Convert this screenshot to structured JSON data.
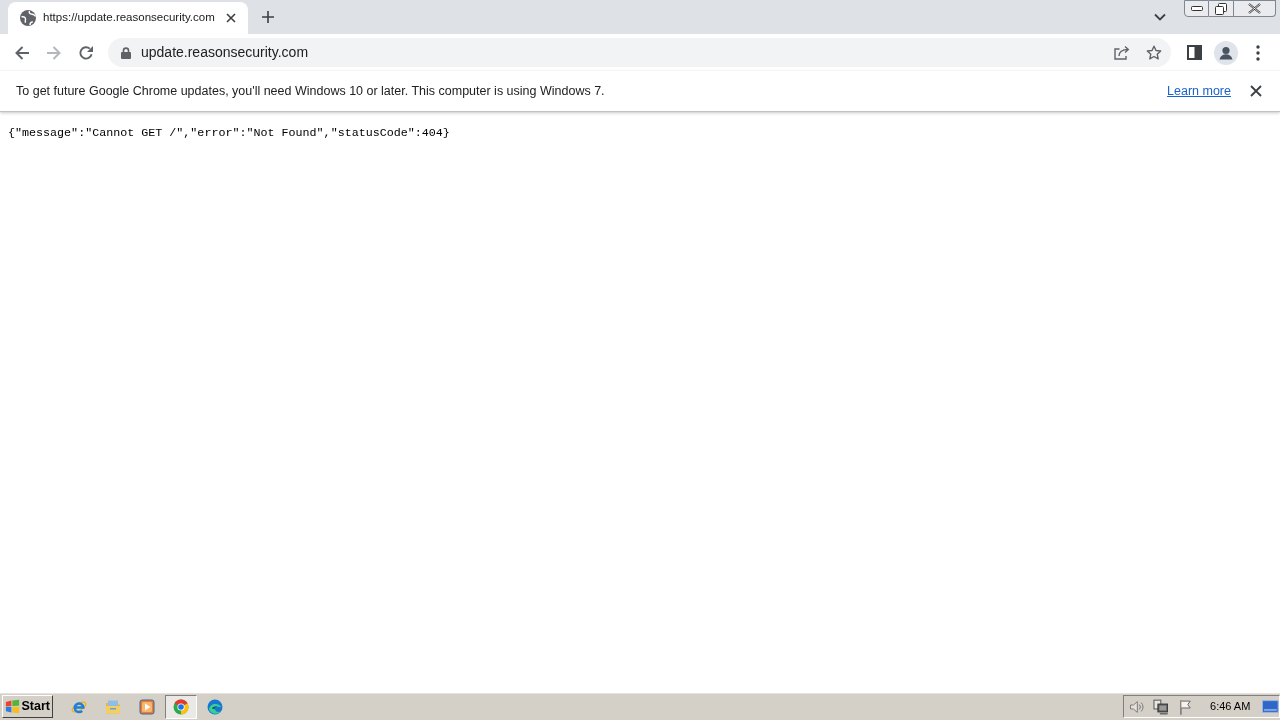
{
  "browser": {
    "tabs": [
      {
        "title": "https://update.reasonsecurity.com",
        "selected": true
      }
    ],
    "navigation": {
      "back_disabled": false,
      "forward_disabled": true
    },
    "address_bar": {
      "url": "update.reasonsecurity.com"
    },
    "infobar": {
      "message": "To get future Google Chrome updates, you'll need Windows 10 or later. This computer is using Windows 7.",
      "link": "Learn more"
    },
    "page": {
      "body": "{\"message\":\"Cannot GET /\",\"error\":\"Not Found\",\"statusCode\":404}"
    }
  },
  "taskbar": {
    "start_button": "Start",
    "quick_launch": [
      {
        "kind": "e_logo",
        "selected": false
      },
      {
        "kind": "folder",
        "selected": false
      },
      {
        "kind": "player",
        "selected": false
      },
      {
        "kind": "ring_logo",
        "selected": true
      },
      {
        "kind": "wave_logo",
        "selected": false
      }
    ],
    "clock": "6:46 AM"
  }
}
